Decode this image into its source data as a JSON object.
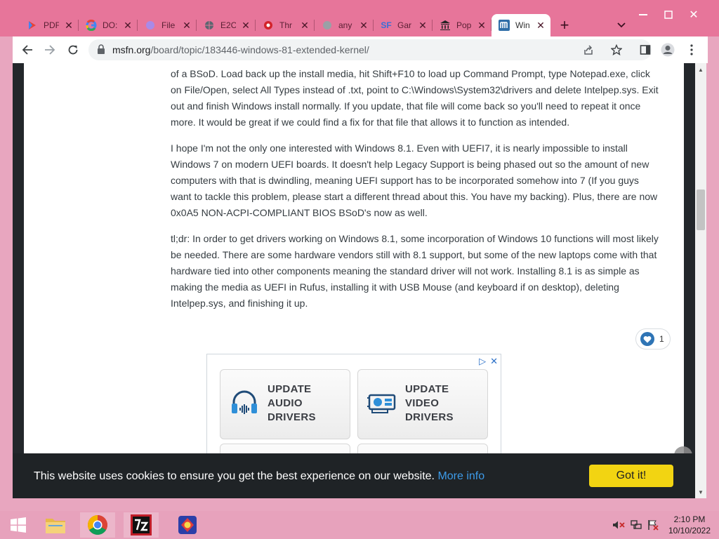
{
  "browser": {
    "tabs": [
      {
        "label": "PDF",
        "icon": "pdf-favicon"
      },
      {
        "label": "DO:",
        "icon": "google-favicon"
      },
      {
        "label": "File",
        "icon": "file-favicon"
      },
      {
        "label": "E2C",
        "icon": "globe-favicon"
      },
      {
        "label": "Thr",
        "icon": "forum-favicon"
      },
      {
        "label": "any",
        "icon": "globe-favicon"
      },
      {
        "label": "Gar",
        "icon": "sf-favicon",
        "glyph": "SF"
      },
      {
        "label": "Pop",
        "icon": "museum-favicon"
      },
      {
        "label": "Win",
        "icon": "msfn-favicon",
        "active": true
      }
    ],
    "new_tab_label": "+",
    "url_domain": "msfn.org",
    "url_path": "/board/topic/183446-windows-81-extended-kernel/"
  },
  "post": {
    "paragraphs": [
      "of a BSoD. Load back up the install media, hit Shift+F10 to load up Command Prompt, type Notepad.exe, click on File/Open, select All Types instead of .txt, point to C:\\Windows\\System32\\drivers and delete Intelpep.sys. Exit out and finish Windows install normally. If you update, that file will come back so you'll need to repeat it once more. It would be great if we could find a fix for that file that allows it to function as intended.",
      "I hope I'm not the only one interested with Windows 8.1. Even with UEFI7, it is nearly impossible to install Windows 7 on modern UEFI boards. It doesn't help Legacy Support is being phased out so the amount of new computers with that is dwindling, meaning UEFI support has to be incorporated somehow into 7 (If you guys want to tackle this problem, please start a different thread about this. You have my backing). Plus, there are now 0x0A5 NON-ACPI-COMPLIANT BIOS BSoD's now as well.",
      "tl;dr: In order to get drivers working on Windows 8.1, some incorporation of Windows 10 functions will most likely be needed. There are some hardware vendors still with 8.1 support, but some of the new laptops come with that hardware tied into other components meaning the standard driver will not work. Installing 8.1 is as simple as making the media as UEFI in Rufus, installing it with USB Mouse (and keyboard if on desktop), deleting Intelpep.sys, and finishing it up."
    ],
    "reaction_count": "1"
  },
  "ad": {
    "cards": [
      {
        "lines": [
          "UPDATE",
          "AUDIO",
          "DRIVERS"
        ],
        "icon": "headphones-icon"
      },
      {
        "lines": [
          "UPDATE",
          "VIDEO",
          "DRIVERS"
        ],
        "icon": "video-card-icon"
      }
    ],
    "adchoices": "▷",
    "close": "✕"
  },
  "cookie": {
    "message": "This website uses cookies to ensure you get the best experience on our website.",
    "more_info": "More info",
    "button": "Got it!"
  },
  "taskbar": {
    "time": "2:10 PM",
    "date": "10/10/2022",
    "apps": [
      "file-explorer",
      "chrome",
      "7-zip",
      "game"
    ]
  },
  "colors": {
    "frame": "#e7759a",
    "taskbar": "#e7a2bc",
    "link": "#3d9be9",
    "cookie_button": "#f2d412",
    "reaction": "#2e74b5"
  }
}
